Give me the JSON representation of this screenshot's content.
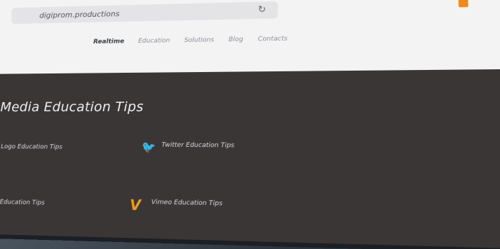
{
  "browser": {
    "url": "digiprom.productions"
  },
  "brand": {
    "text": ""
  },
  "nav": {
    "items": [
      "Realtime",
      "Education",
      "Solutions",
      "Blog",
      "Contacts"
    ],
    "active": 0
  },
  "page": {
    "title": "Media Education Tips"
  },
  "cards": [
    {
      "title": "Logo Education Tips",
      "text": ""
    },
    {
      "title": "Twitter Education Tips",
      "text": ""
    },
    {
      "title": "Education Tips",
      "text": ""
    },
    {
      "title": "Vimeo Education Tips",
      "text": ""
    }
  ],
  "colors": {
    "accent": "#f29a1f",
    "topbar": "#f3f3f4",
    "content_bg": "#3b3636"
  },
  "icons": {
    "reload": "reload-icon",
    "twitter": "twitter-icon",
    "vimeo": "vimeo-icon"
  }
}
